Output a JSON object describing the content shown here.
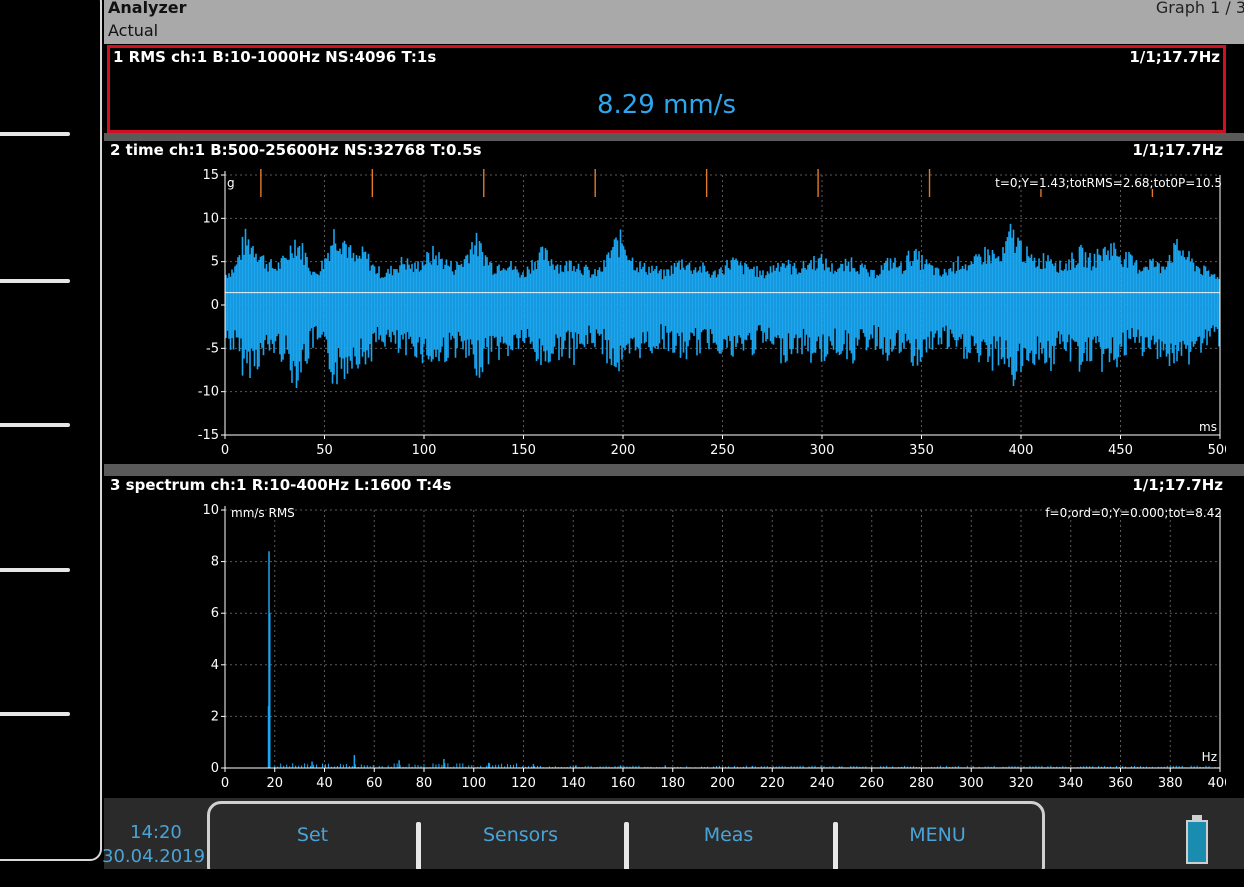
{
  "header": {
    "title": "Analyzer",
    "subtitle": "Actual",
    "graph_indicator": "Graph 1 / 3"
  },
  "panel_rms": {
    "title": "1 RMS ch:1 B:10-1000Hz NS:4096 T:1s",
    "right": "1/1;17.7Hz",
    "value": "8.29 mm/s"
  },
  "panel_time": {
    "title": "2 time ch:1 B:500-25600Hz NS:32768 T:0.5s",
    "right": "1/1;17.7Hz",
    "cursor_readout": "t=0;Y=1.43;totRMS=2.68;tot0P=10.5",
    "y_unit": "g",
    "x_unit": "ms"
  },
  "panel_spectrum": {
    "title": "3 spectrum ch:1 R:10-400Hz L:1600 T:4s",
    "right": "1/1;17.7Hz",
    "cursor_readout": "f=0;ord=0;Y=0.000;tot=8.42",
    "y_unit": "mm/s RMS",
    "x_unit": "Hz"
  },
  "status": {
    "time": "14:20",
    "date": "30.04.2019"
  },
  "softkeys": [
    "Set",
    "Sensors",
    "Meas",
    "MENU"
  ],
  "colors": {
    "signal": "#1aa6f0",
    "panel_border": "#d01020",
    "marker": "#e07a2a",
    "text_accent": "#4aa3d6"
  },
  "chart_data": [
    {
      "type": "line",
      "x_ticks": [
        0,
        50,
        100,
        150,
        200,
        250,
        300,
        350,
        400,
        450,
        500
      ],
      "y_ticks": [
        15,
        10,
        5,
        0,
        -5,
        -10,
        -15
      ],
      "xlim": [
        0,
        500
      ],
      "ylim": [
        -15,
        15
      ],
      "envelope_ms": [
        0,
        5,
        10,
        15,
        20,
        25,
        30,
        35,
        40,
        45,
        50,
        55,
        60,
        65,
        70,
        75,
        80,
        85,
        90,
        95,
        100,
        105,
        110,
        115,
        120,
        125,
        130,
        135,
        140,
        145,
        150,
        155,
        160,
        165,
        170,
        175,
        180,
        185,
        190,
        195,
        200,
        205,
        210,
        215,
        220,
        225,
        230,
        235,
        240,
        245,
        250,
        255,
        260,
        265,
        270,
        275,
        280,
        285,
        290,
        295,
        300,
        305,
        310,
        315,
        320,
        325,
        330,
        335,
        340,
        345,
        350,
        355,
        360,
        365,
        370,
        375,
        380,
        385,
        390,
        395,
        400,
        405,
        410,
        415,
        420,
        425,
        430,
        435,
        440,
        445,
        450,
        455,
        460,
        465,
        470,
        475,
        480,
        485,
        490,
        495,
        500
      ],
      "envelope_max": [
        4,
        5,
        9,
        8,
        6,
        5,
        6,
        9,
        7,
        4,
        6,
        10,
        9,
        6,
        7,
        5,
        4,
        5,
        6,
        5,
        6,
        7,
        6,
        5,
        6,
        9,
        7,
        5,
        6,
        5,
        4,
        6,
        7,
        6,
        5,
        6,
        5,
        4,
        5,
        8,
        9,
        6,
        5,
        5,
        4,
        5,
        6,
        5,
        5,
        4,
        5,
        6,
        5,
        5,
        4,
        5,
        6,
        5,
        5,
        6,
        6,
        5,
        5,
        6,
        5,
        4,
        5,
        6,
        5,
        7,
        6,
        5,
        4,
        5,
        6,
        5,
        7,
        7,
        6,
        10,
        8,
        6,
        6,
        7,
        5,
        6,
        7,
        6,
        7,
        8,
        7,
        6,
        5,
        6,
        5,
        7,
        8,
        6,
        5,
        4,
        4
      ],
      "envelope_min": [
        -5,
        -6,
        -9,
        -8,
        -7,
        -6,
        -7,
        -10,
        -8,
        -5,
        -7,
        -10,
        -9,
        -7,
        -8,
        -6,
        -5,
        -6,
        -7,
        -6,
        -7,
        -8,
        -7,
        -6,
        -7,
        -9,
        -8,
        -6,
        -7,
        -6,
        -5,
        -7,
        -8,
        -7,
        -6,
        -7,
        -6,
        -5,
        -6,
        -8,
        -9,
        -7,
        -6,
        -6,
        -5,
        -6,
        -7,
        -6,
        -6,
        -5,
        -6,
        -7,
        -6,
        -6,
        -5,
        -6,
        -7,
        -6,
        -6,
        -7,
        -7,
        -6,
        -6,
        -7,
        -6,
        -5,
        -6,
        -7,
        -6,
        -8,
        -7,
        -6,
        -5,
        -6,
        -7,
        -6,
        -8,
        -8,
        -7,
        -10,
        -9,
        -7,
        -7,
        -8,
        -6,
        -7,
        -8,
        -7,
        -8,
        -8,
        -7,
        -6,
        -6,
        -7,
        -6,
        -8,
        -8,
        -7,
        -6,
        -5,
        -5
      ],
      "cursor_y": 1.43,
      "markers_ms": [
        12,
        68,
        124,
        180,
        236,
        292,
        348,
        404,
        460
      ]
    },
    {
      "type": "bar",
      "x_ticks": [
        0,
        20,
        40,
        60,
        80,
        100,
        120,
        140,
        160,
        180,
        200,
        220,
        240,
        260,
        280,
        300,
        320,
        340,
        360,
        380,
        400
      ],
      "y_ticks": [
        10,
        8,
        6,
        4,
        2,
        0
      ],
      "xlim": [
        0,
        400
      ],
      "ylim": [
        0,
        10
      ],
      "x": [
        17.5,
        17.7,
        18.0,
        35,
        52,
        70,
        88,
        106,
        124,
        141,
        159,
        177,
        212,
        247
      ],
      "y": [
        2.4,
        8.4,
        6.0,
        0.25,
        0.5,
        0.3,
        0.35,
        0.2,
        0.15,
        0.1,
        0.1,
        0.1,
        0.08,
        0.06
      ]
    }
  ]
}
